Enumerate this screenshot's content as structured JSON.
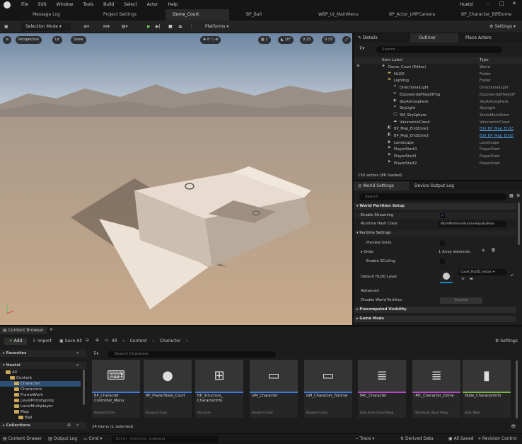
{
  "menu": {
    "items": [
      "File",
      "Edit",
      "Window",
      "Tools",
      "Build",
      "Select",
      "Actor",
      "Help"
    ],
    "project": "Huetzi"
  },
  "tabs": [
    "Message Log",
    "Project Settings",
    "Dome_Court",
    "BP_Ball",
    "WBP_UI_MainMenu",
    "BP_Actor_LMPCamera",
    "BP_Character_BiffDome"
  ],
  "toolbar": {
    "mode": "Selection Mode",
    "platforms": "Platforms",
    "settings": "Settings"
  },
  "viewport": {
    "perspective": "Perspective",
    "lit": "Lit",
    "show": "Show",
    "grid": "1",
    "angle": "10°",
    "scale": "0.25",
    "speed": "0.33"
  },
  "outliner": {
    "tabs": [
      "Details",
      "Outliner",
      "Place Actors"
    ],
    "search_placeholder": "Search...",
    "col_label": "Item Label",
    "col_type": "Type",
    "rows": [
      {
        "label": "Dome_Court (Editor)",
        "type": "World"
      },
      {
        "label": "HLOD",
        "type": "Folder"
      },
      {
        "label": "Lighting",
        "type": "Folder"
      },
      {
        "label": "DirectionalLight",
        "type": "DirectionalLight"
      },
      {
        "label": "ExponentialHeightFog",
        "type": "ExponentialHeightF"
      },
      {
        "label": "SkyAtmosphere",
        "type": "SkyAtmosphere"
      },
      {
        "label": "SkyLight",
        "type": "SkyLight"
      },
      {
        "label": "SM_SkySphere",
        "type": "StaticMeshActor"
      },
      {
        "label": "VolumetricCloud",
        "type": "VolumetricCloud"
      },
      {
        "label": "BP_Map_EndZone1",
        "type": "Edit BP_Map_EndZ"
      },
      {
        "label": "BP_Map_EndZone2",
        "type": "Edit BP_Map_EndZ"
      },
      {
        "label": "Landscape",
        "type": "Landscape"
      },
      {
        "label": "PlayerStart0",
        "type": "PlayerStart"
      },
      {
        "label": "PlayerStart1",
        "type": "PlayerStart"
      },
      {
        "label": "PlayerStart2",
        "type": "PlayerStart"
      }
    ],
    "footer": "150 actors (86 loaded)"
  },
  "world_settings": {
    "tabs": [
      "World Settings",
      "Device Output Log"
    ],
    "search_placeholder": "Search",
    "section_partition": "World Partition Setup",
    "enable_streaming": "Enable Streaming",
    "runtime_hash": "Runtime Hash Class",
    "runtime_hash_value": "WorldPartitionRuntimeSpatialHas",
    "runtime_settings": "Runtime Settings",
    "preview_grids": "Preview Grids",
    "grids": "Grids",
    "grids_value": "1 Array elements",
    "enable_zculling": "Enable ZCulling",
    "default_hlod": "Default HLOD Layer",
    "hlod_value": "Court_HLOD_Instan",
    "advanced": "Advanced",
    "disable_wp": "Disable World Partition",
    "disable_btn": "Disable",
    "precomputed": "Precomputed Visibility",
    "game_mode": "Game Mode"
  },
  "content_browser": {
    "tab": "Content Browser",
    "add": "Add",
    "import": "Import",
    "save_all": "Save All",
    "path": [
      "All",
      "Content",
      "Character"
    ],
    "settings": "Settings",
    "favorites": "Favorites",
    "project": "Huetzi",
    "search_placeholder": "Search Character",
    "tree": [
      "All",
      "Content",
      "Character",
      "Characters",
      "FrameWork",
      "LevelPrototyping",
      "LocalMultiplayer",
      "Map",
      "Ball"
    ],
    "collections": "Collections",
    "count": "24 items (1 selected)",
    "assets": [
      {
        "name": "BP_Character Controller_Menu",
        "type": "Blueprint Class",
        "bar": "#3a7bd5"
      },
      {
        "name": "BP_PlayerState_Court",
        "type": "Blueprint Class",
        "bar": "#3a7bd5"
      },
      {
        "name": "BP_Structure_ CharacterInfo",
        "type": "Structure",
        "bar": "#3a7bd5"
      },
      {
        "name": "GM_Character",
        "type": "Blueprint Class",
        "bar": "#3a7bd5"
      },
      {
        "name": "GM_Character_Tutorial",
        "type": "Blueprint Class",
        "bar": "#3a7bd5"
      },
      {
        "name": "IMC_Character",
        "type": "Data Asset (Input Mapp...",
        "bar": "#b04bc4"
      },
      {
        "name": "IMC_Character_Dome",
        "type": "Data Asset (Input Mapp...",
        "bar": "#b04bc4"
      },
      {
        "name": "Table_CharacterInfo",
        "type": "Data Table",
        "bar": "#7cb342"
      }
    ]
  },
  "status": {
    "drawer": "Content Drawer",
    "output": "Output Log",
    "cmd": "Cmd",
    "console_placeholder": "Enter Console Command",
    "trace": "Trace",
    "derived": "Derived Data",
    "saved": "All Saved",
    "revision": "Revision Control"
  }
}
